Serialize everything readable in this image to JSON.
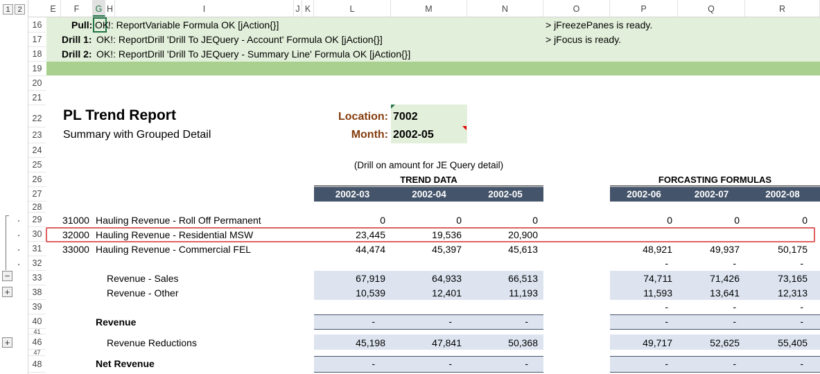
{
  "outline_levels": [
    "1",
    "2"
  ],
  "columns": [
    "E",
    "F",
    "G",
    "H",
    "I",
    "J",
    "K",
    "L",
    "M",
    "N",
    "O",
    "P",
    "Q",
    "R"
  ],
  "selected_column": "G",
  "row_numbers": [
    "16",
    "17",
    "18",
    "19",
    "20",
    "21",
    "22",
    "23",
    "24",
    "25",
    "26",
    "27",
    "28",
    "29",
    "30",
    "31",
    "32",
    "33",
    "38",
    "39",
    "40",
    "41",
    "46",
    "47",
    "48"
  ],
  "status": {
    "pull_label": "Pull:",
    "pull_ok": "OK",
    "pull_text": "!: ReportVariable Formula OK [jAction{}]",
    "drill1_label": "Drill 1:",
    "drill1_text": "OK!: ReportDrill 'Drill To JEQuery - Account' Formula OK [jAction{}]",
    "drill2_label": "Drill 2:",
    "drill2_text": "OK!: ReportDrill 'Drill To JEQuery - Summary Line' Formula OK [jAction{}]",
    "freeze_msg": "> jFreezePanes is ready.",
    "focus_msg": "> jFocus is ready."
  },
  "report": {
    "title": "PL Trend Report",
    "subtitle": "Summary with Grouped Detail",
    "location_label": "Location:",
    "location_value": "7002",
    "month_label": "Month:",
    "month_value": "2002-05",
    "drill_note": "(Drill on amount for JE Query detail)",
    "trend_header": "TREND DATA",
    "forecast_header": "FORCASTING FORMULAS",
    "trend_periods": [
      "2002-03",
      "2002-04",
      "2002-05"
    ],
    "forecast_periods": [
      "2002-06",
      "2002-07",
      "2002-08"
    ]
  },
  "rows": [
    {
      "code": "31000",
      "name": "Hauling Revenue - Roll Off Permanent",
      "trend": [
        "0",
        "0",
        "0"
      ],
      "forecast": [
        "0",
        "0",
        "0"
      ]
    },
    {
      "code": "32000",
      "name": "Hauling Revenue - Residential MSW",
      "trend": [
        "23,445",
        "19,536",
        "20,900"
      ],
      "forecast": [
        "",
        "",
        ""
      ]
    },
    {
      "code": "33000",
      "name": "Hauling Revenue - Commercial FEL",
      "trend": [
        "44,474",
        "45,397",
        "45,613"
      ],
      "forecast": [
        "48,921",
        "49,937",
        "50,175"
      ]
    },
    {
      "code": "",
      "name": "",
      "trend": [
        "",
        "",
        ""
      ],
      "forecast": [
        "-",
        "-",
        "-"
      ]
    },
    {
      "code": "",
      "name": "Revenue - Sales",
      "trend": [
        "67,919",
        "64,933",
        "66,513"
      ],
      "forecast": [
        "74,711",
        "71,426",
        "73,165"
      ]
    },
    {
      "code": "",
      "name": "Revenue - Other",
      "trend": [
        "10,539",
        "12,401",
        "11,193"
      ],
      "forecast": [
        "11,593",
        "13,641",
        "12,313"
      ]
    },
    {
      "code": "",
      "name": "",
      "trend": [
        "",
        "",
        ""
      ],
      "forecast": [
        "-",
        "-",
        "-"
      ]
    },
    {
      "code": "",
      "name": "Revenue",
      "trend": [
        "-",
        "-",
        "-"
      ],
      "forecast": [
        "-",
        "-",
        "-"
      ]
    },
    {
      "code": "",
      "name": "Revenue Reductions",
      "trend": [
        "45,198",
        "47,841",
        "50,368"
      ],
      "forecast": [
        "49,717",
        "52,625",
        "55,405"
      ]
    },
    {
      "code": "",
      "name": "Net Revenue",
      "trend": [
        "-",
        "-",
        "-"
      ],
      "forecast": [
        "-",
        "-",
        "-"
      ]
    }
  ],
  "outline_buttons": [
    "−",
    "+",
    "+"
  ]
}
